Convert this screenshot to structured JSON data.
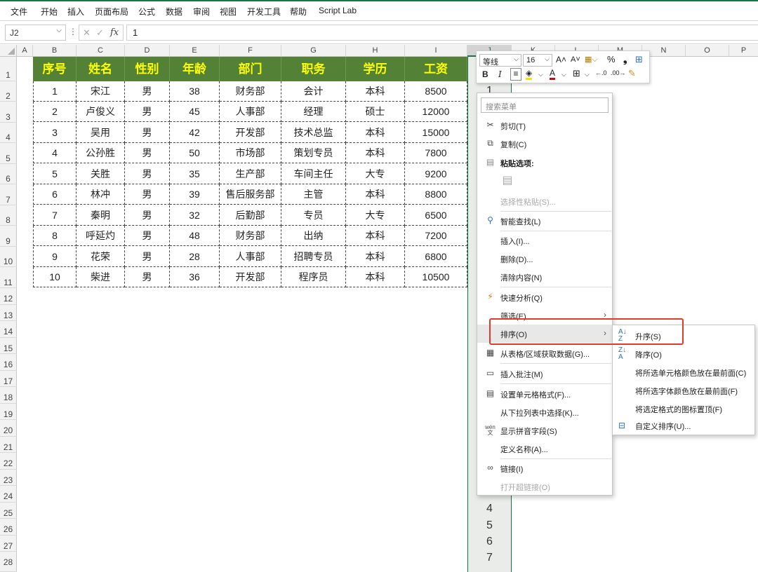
{
  "ribbon": {
    "tabs": [
      "文件",
      "开始",
      "插入",
      "页面布局",
      "公式",
      "数据",
      "审阅",
      "视图",
      "开发工具",
      "帮助",
      "Script Lab"
    ]
  },
  "formula_bar": {
    "name_box": "J2",
    "formula": "1"
  },
  "columns": [
    "A",
    "B",
    "C",
    "D",
    "E",
    "F",
    "G",
    "H",
    "I",
    "J",
    "K",
    "L",
    "M",
    "N",
    "O",
    "P"
  ],
  "rows": [
    "1",
    "2",
    "3",
    "4",
    "5",
    "6",
    "7",
    "8",
    "9",
    "10",
    "11",
    "12",
    "13",
    "14",
    "15",
    "16",
    "17",
    "18",
    "19",
    "20",
    "21",
    "22",
    "23",
    "24",
    "25",
    "26",
    "27",
    "28"
  ],
  "table": {
    "headers": [
      "序号",
      "姓名",
      "性别",
      "年龄",
      "部门",
      "职务",
      "学历",
      "工资"
    ],
    "rows": [
      [
        "1",
        "宋江",
        "男",
        "38",
        "财务部",
        "会计",
        "本科",
        "8500"
      ],
      [
        "2",
        "卢俊义",
        "男",
        "45",
        "人事部",
        "经理",
        "硕士",
        "12000"
      ],
      [
        "3",
        "吴用",
        "男",
        "42",
        "开发部",
        "技术总监",
        "本科",
        "15000"
      ],
      [
        "4",
        "公孙胜",
        "男",
        "50",
        "市场部",
        "策划专员",
        "本科",
        "7800"
      ],
      [
        "5",
        "关胜",
        "男",
        "35",
        "生产部",
        "车间主任",
        "大专",
        "9200"
      ],
      [
        "6",
        "林冲",
        "男",
        "39",
        "售后服务部",
        "主管",
        "本科",
        "8800"
      ],
      [
        "7",
        "秦明",
        "男",
        "32",
        "后勤部",
        "专员",
        "大专",
        "6500"
      ],
      [
        "8",
        "呼延灼",
        "男",
        "48",
        "财务部",
        "出纳",
        "本科",
        "7200"
      ],
      [
        "9",
        "花荣",
        "男",
        "28",
        "人事部",
        "招聘专员",
        "本科",
        "6800"
      ],
      [
        "10",
        "柴进",
        "男",
        "36",
        "开发部",
        "程序员",
        "本科",
        "10500"
      ]
    ]
  },
  "selected_column_values": {
    "top": "1",
    "bottom": [
      "4",
      "5",
      "6",
      "7"
    ]
  },
  "mini_toolbar": {
    "font_name": "等线",
    "font_size": "16"
  },
  "context_menu": {
    "search_placeholder": "搜索菜单",
    "cut": "剪切(T)",
    "copy": "复制(C)",
    "paste_options": "粘贴选项:",
    "paste_special": "选择性粘贴(S)...",
    "smart_lookup": "智能查找(L)",
    "insert": "插入(I)...",
    "delete": "删除(D)...",
    "clear": "清除内容(N)",
    "quick_analysis": "快速分析(Q)",
    "filter": "筛选(E)",
    "sort": "排序(O)",
    "get_data": "从表格/区域获取数据(G)...",
    "insert_comment": "插入批注(M)",
    "format_cells": "设置单元格格式(F)...",
    "pick_from_list": "从下拉列表中选择(K)...",
    "phonetic": "显示拼音字段(S)",
    "define_name": "定义名称(A)...",
    "link": "链接(I)",
    "open_link": "打开超链接(O)"
  },
  "sort_submenu": {
    "ascending": "升序(S)",
    "descending": "降序(O)",
    "cell_color": "将所选单元格颜色放在最前面(C)",
    "font_color": "将所选字体颜色放在最前面(F)",
    "icon": "将选定格式的图标置顶(F)",
    "custom": "自定义排序(U)..."
  },
  "colors": {
    "header_fill": "#538135",
    "header_text": "#ffff00",
    "excel_green": "#1e7145",
    "highlight": "#e03a2f"
  }
}
